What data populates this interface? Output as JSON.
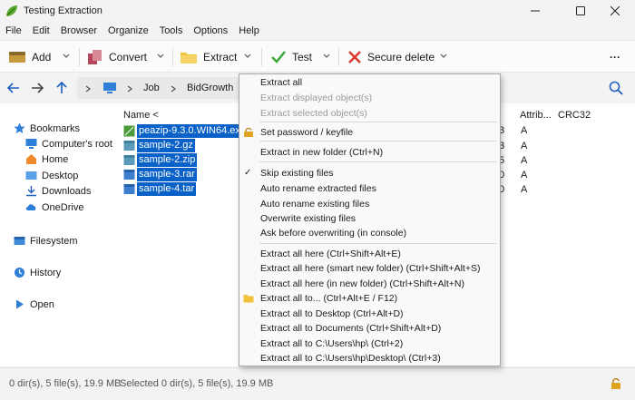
{
  "window": {
    "title": "Testing Extraction"
  },
  "menubar": {
    "items": [
      "File",
      "Edit",
      "Browser",
      "Organize",
      "Tools",
      "Options",
      "Help"
    ]
  },
  "toolbar": {
    "add_label": "Add",
    "convert_label": "Convert",
    "extract_label": "Extract",
    "test_label": "Test",
    "secure_delete_label": "Secure delete",
    "more_label": "···"
  },
  "address": {
    "crumbs": [
      "Job",
      "BidGrowth"
    ]
  },
  "sidebar": {
    "bookmarks": "Bookmarks",
    "items": [
      "Computer's root",
      "Home",
      "Desktop",
      "Downloads",
      "OneDrive"
    ],
    "filesystem": "Filesystem",
    "history": "History",
    "open": "Open"
  },
  "files": {
    "headers": {
      "name": "Name <",
      "attrib": "Attrib...",
      "crc": "CRC32"
    },
    "rows": [
      {
        "name": "peazip-9.3.0.WIN64.exe",
        "size_tail": "3",
        "attr": "A"
      },
      {
        "name": "sample-2.gz",
        "size_tail": "3",
        "attr": "A"
      },
      {
        "name": "sample-2.zip",
        "size_tail": "5",
        "attr": "A"
      },
      {
        "name": "sample-3.rar",
        "size_tail": "0",
        "attr": "A"
      },
      {
        "name": "sample-4.tar",
        "size_tail": "0",
        "attr": "A"
      }
    ]
  },
  "context_menu": {
    "items": [
      "Extract all",
      "Extract displayed object(s)",
      "Extract selected object(s)",
      "Set password / keyfile",
      "Extract in new folder (Ctrl+N)",
      "Skip existing files",
      "Auto rename extracted files",
      "Auto rename existing files",
      "Overwrite existing files",
      "Ask before overwriting (in console)",
      "Extract all here (Ctrl+Shift+Alt+E)",
      "Extract all here (smart new folder) (Ctrl+Shift+Alt+S)",
      "Extract all here (in new folder) (Ctrl+Shift+Alt+N)",
      "Extract all to... (Ctrl+Alt+E / F12)",
      "Extract all to Desktop (Ctrl+Alt+D)",
      "Extract all to Documents (Ctrl+Shift+Alt+D)",
      "Extract all to C:\\Users\\hp\\ (Ctrl+2)",
      "Extract all to C:\\Users\\hp\\Desktop\\ (Ctrl+3)"
    ],
    "check_mark": "✓"
  },
  "status": {
    "left": "0 dir(s), 5 file(s), 19.9 MB",
    "right": "Selected 0 dir(s), 5 file(s), 19.9 MB"
  },
  "colors": {
    "accent": "#0a62c8",
    "background": "#f3f3f3",
    "panel": "#ffffff",
    "menu_bg": "#f9f9f9"
  }
}
